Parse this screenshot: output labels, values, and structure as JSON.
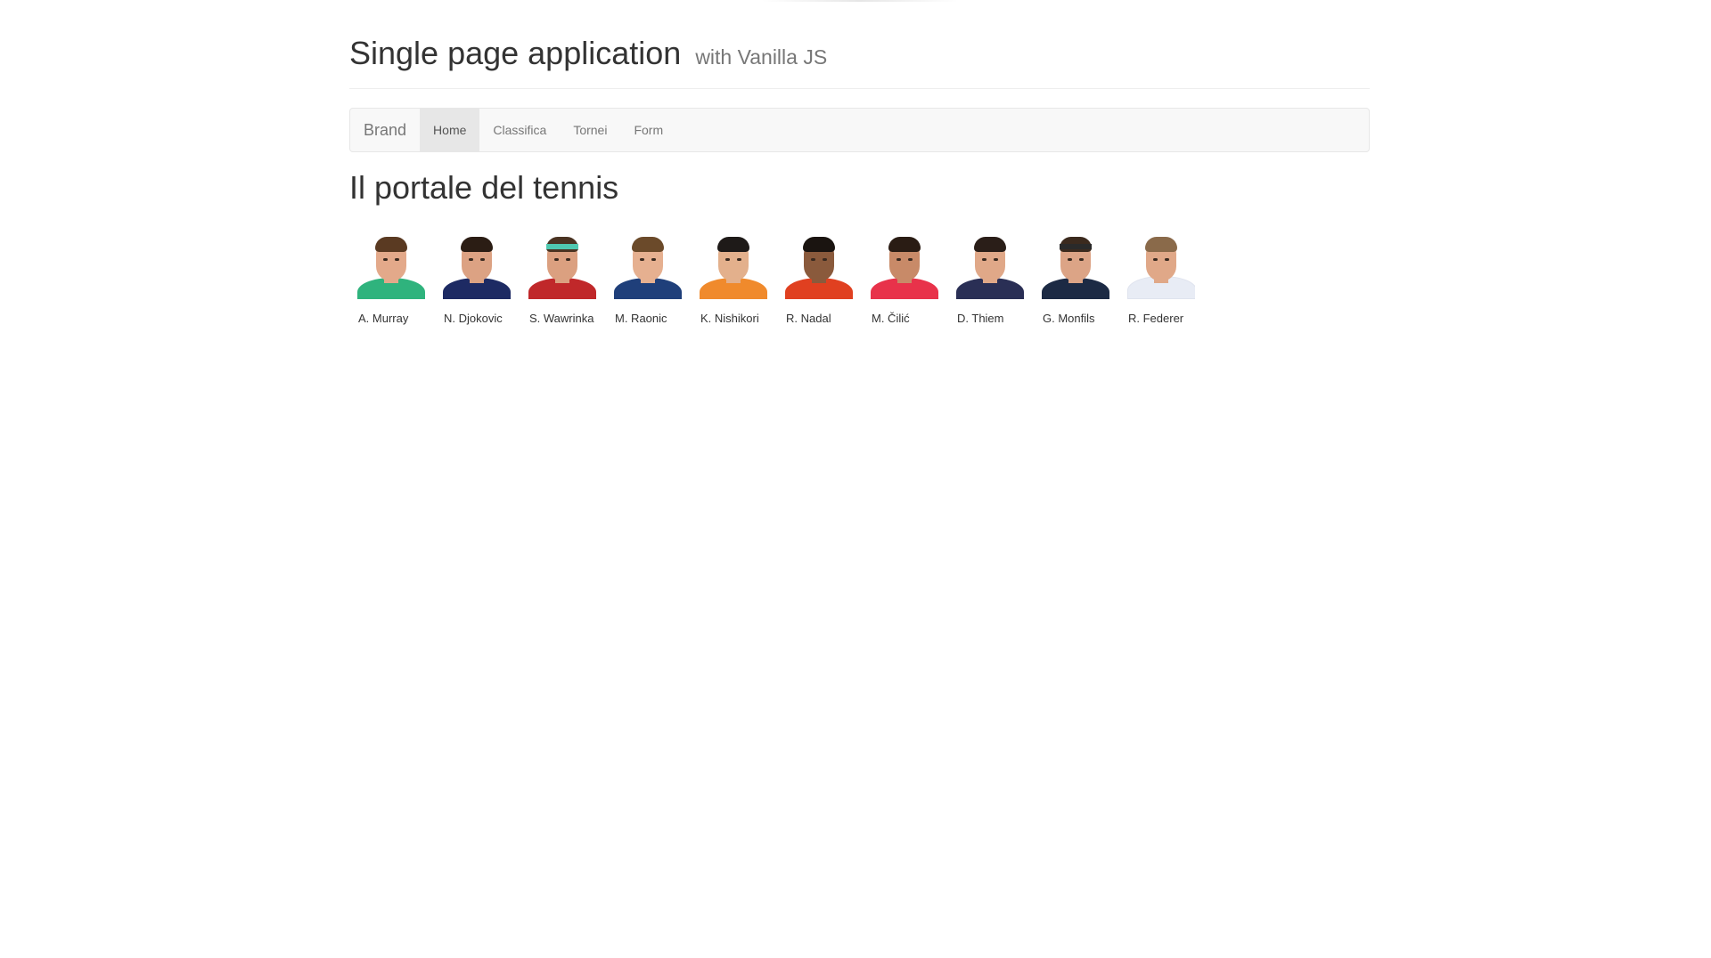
{
  "header": {
    "title": "Single page application",
    "subtitle": "with Vanilla JS"
  },
  "navbar": {
    "brand": "Brand",
    "items": [
      {
        "label": "Home",
        "active": true
      },
      {
        "label": "Classifica",
        "active": false
      },
      {
        "label": "Tornei",
        "active": false
      },
      {
        "label": "Form",
        "active": false
      }
    ]
  },
  "main": {
    "title": "Il portale del tennis",
    "players": [
      {
        "name": "A. Murray",
        "shirt": "#2fb37d",
        "hair": "#5a3a22",
        "skin": "#e3a98a"
      },
      {
        "name": "N. Djokovic",
        "shirt": "#1d2a63",
        "hair": "#2b1d14",
        "skin": "#dca283"
      },
      {
        "name": "S. Wawrinka",
        "shirt": "#c0282a",
        "hair": "#4a3322",
        "skin": "#dba080",
        "band": "#4fc8b0"
      },
      {
        "name": "M. Raonic",
        "shirt": "#1f3f7a",
        "hair": "#6b4a2a",
        "skin": "#e6b090"
      },
      {
        "name": "K. Nishikori",
        "shirt": "#f08a2c",
        "hair": "#1e1a18",
        "skin": "#e3b08c"
      },
      {
        "name": "R. Nadal",
        "shirt": "#e04020",
        "hair": "#1a1410",
        "skin": "#8a5a3c"
      },
      {
        "name": "M. Čilić",
        "shirt": "#e8324a",
        "hair": "#2a1c14",
        "skin": "#c88a68"
      },
      {
        "name": "D. Thiem",
        "shirt": "#2a2f55",
        "hair": "#2a1e18",
        "skin": "#e0a888"
      },
      {
        "name": "G. Monfils",
        "shirt": "#1c2a44",
        "hair": "#3b2a1e",
        "skin": "#dca486",
        "band": "#2a2a2a"
      },
      {
        "name": "R. Federer",
        "shirt": "#e8ecf5",
        "hair": "#8a6a4a",
        "skin": "#e0a888"
      }
    ]
  }
}
